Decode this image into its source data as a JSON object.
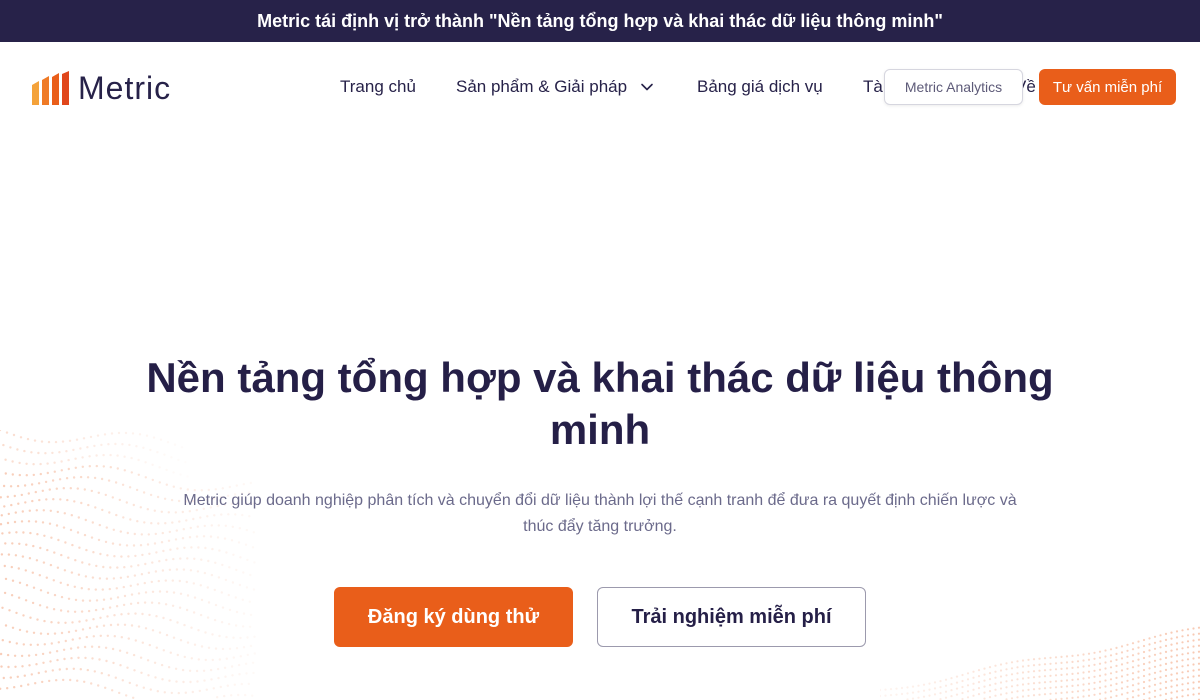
{
  "announcement": {
    "text": "Metric tái định vị trở thành \"Nền tảng tổng hợp và khai thác dữ liệu thông minh\""
  },
  "brand": {
    "name": "Metric",
    "accent": "#e95e1a",
    "dark": "#272249",
    "logo_icon": "bar-chart-logo-icon"
  },
  "nav": {
    "home": "Trang chủ",
    "products": "Sản phẩm & Giải pháp",
    "pricing": "Bảng giá dịch vụ",
    "resources": "Tài",
    "about": "Về",
    "tooltip": "Metric Analytics",
    "cta": "Tư vấn miễn phí"
  },
  "hero": {
    "title": "Nền tảng tổng hợp và khai thác dữ liệu thông minh",
    "subtitle": "Metric giúp doanh nghiệp phân tích và chuyển đổi dữ liệu thành lợi thế cạnh tranh để đưa ra quyết định chiến lược và thúc đẩy tăng trưởng.",
    "primary_button": "Đăng ký dùng thử",
    "secondary_button": "Trải nghiệm miễn phí"
  }
}
